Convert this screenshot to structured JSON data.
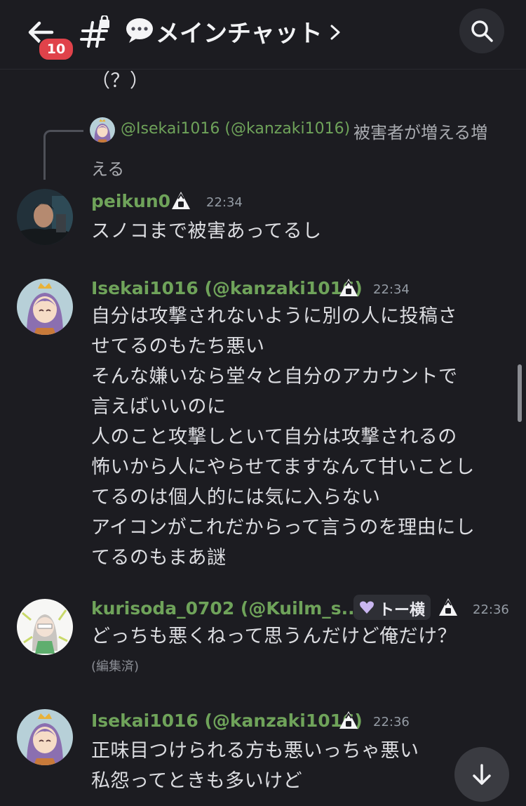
{
  "header": {
    "unread_count": "10",
    "channel_emoji": "speech-balloon",
    "channel_name": "メインチャット",
    "back_icon": "arrow-left-icon",
    "channel_icon": "hash-lock-icon",
    "search_icon": "search-icon"
  },
  "messages": {
    "cutoff": {
      "line1": "（？）"
    },
    "reply": {
      "author": "@Isekai1016 (@kanzaki1016)",
      "text_part1": "被害者が増える増",
      "text_part2": "える"
    },
    "m1": {
      "username": "peikun0",
      "time": "22:34",
      "line1": "スノコまで被害あってるし"
    },
    "m2": {
      "username": "Isekai1016 (@kanzaki1016)",
      "time": "22:34",
      "lines": [
        "自分は攻撃されないように別の人に投稿さ",
        "せてるのもたち悪い",
        "そんな嫌いなら堂々と自分のアカウントで",
        "言えばいいのに",
        "人のこと攻撃しといて自分は攻撃されるの",
        "怖いから人にやらせてますなんて甘いことし",
        "てるのは個人的には気に入らない",
        "アイコンがこれだからって言うのを理由にし",
        "てるのもまあ謎"
      ]
    },
    "m3": {
      "username": "kurisoda_0702 (@Kuilm_s...",
      "tag_label": "トー横",
      "time": "22:36",
      "line1": "どっちも悪くねって思うんだけど俺だけ？",
      "edited": "(編集済)"
    },
    "m4": {
      "username": "Isekai1016 (@kanzaki1016)",
      "time": "22:36",
      "line1": "正味目つけられる方も悪いっちゃ悪い",
      "line2": "私怨ってときも多いけど"
    }
  },
  "colors": {
    "background": "#1c1c21",
    "username_green": "#6fa35a",
    "badge_red": "#e0424a",
    "text": "#dcdde1",
    "muted": "#949ba4"
  },
  "jump_button": {
    "icon": "arrow-down-icon"
  }
}
